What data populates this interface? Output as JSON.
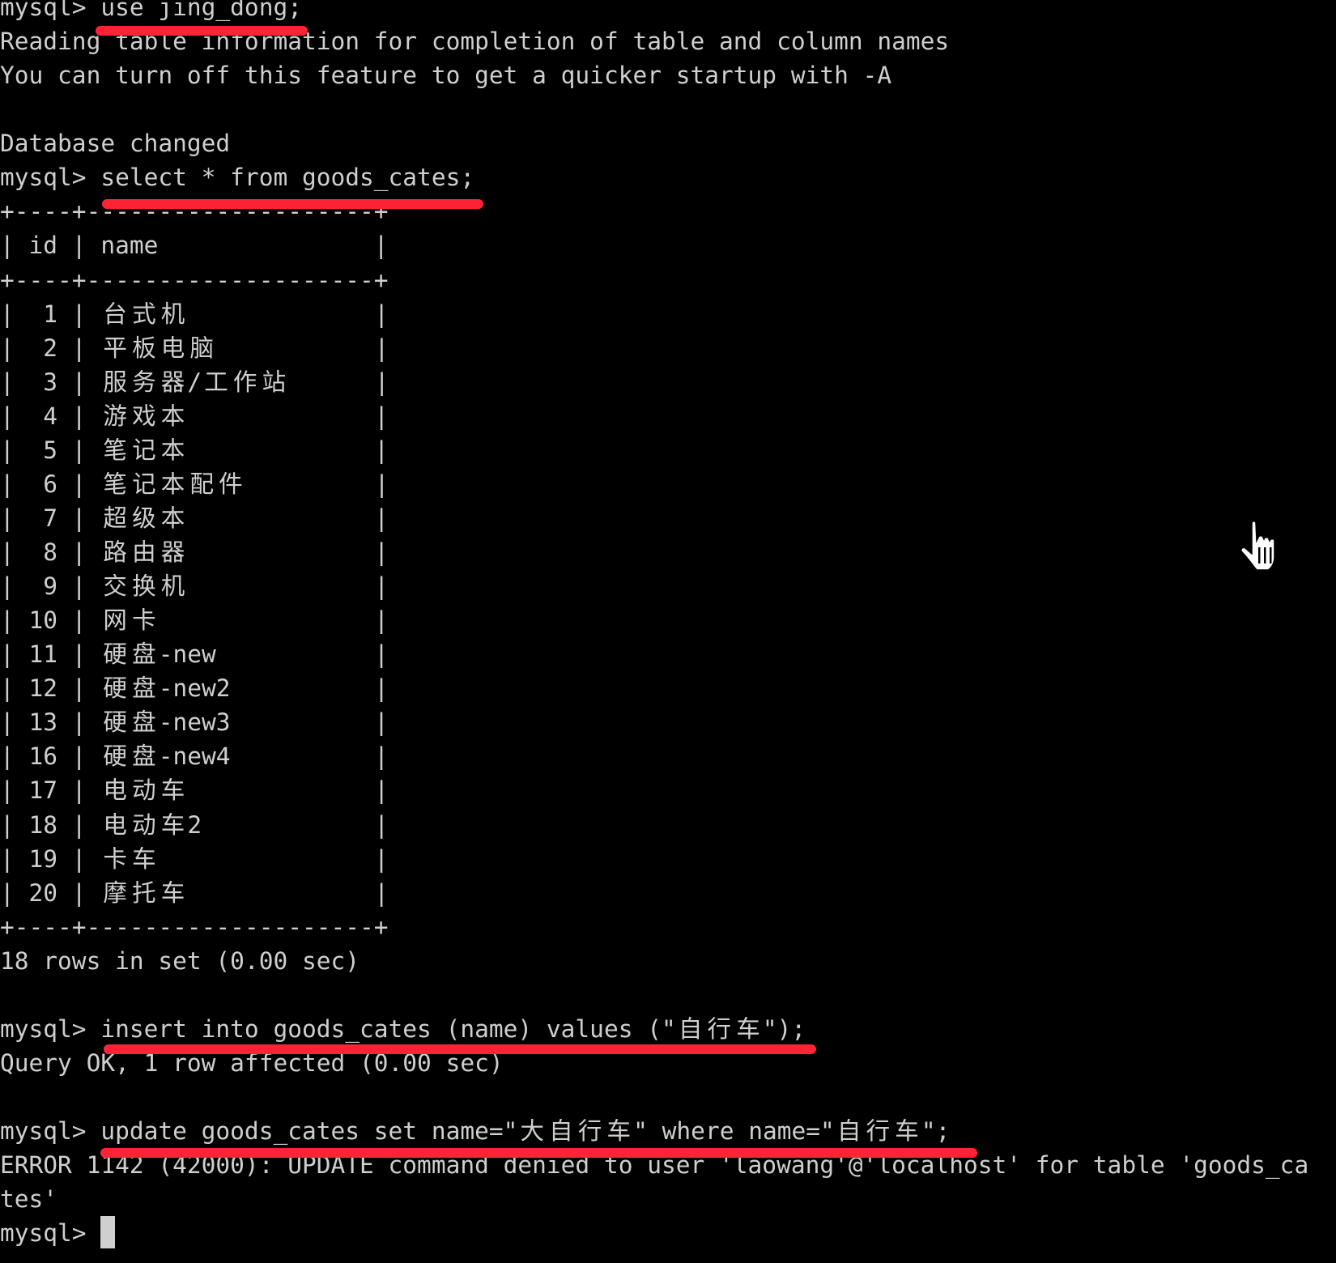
{
  "terminal": {
    "prompt": "mysql> ",
    "lines": [
      {
        "type": "command",
        "text": "use jing_dong;"
      },
      {
        "type": "output",
        "text": "Reading table information for completion of table and column names"
      },
      {
        "type": "output",
        "text": "You can turn off this feature to get a quicker startup with -A"
      },
      {
        "type": "blank",
        "text": ""
      },
      {
        "type": "output",
        "text": "Database changed"
      },
      {
        "type": "command",
        "text": "select * from goods_cates;"
      }
    ],
    "table": {
      "border": "+----+--------------------+",
      "columns": [
        "id",
        "name"
      ],
      "rows": [
        {
          "id": "1",
          "name": "台式机"
        },
        {
          "id": "2",
          "name": "平板电脑"
        },
        {
          "id": "3",
          "name": "服务器/工作站"
        },
        {
          "id": "4",
          "name": "游戏本"
        },
        {
          "id": "5",
          "name": "笔记本"
        },
        {
          "id": "6",
          "name": "笔记本配件"
        },
        {
          "id": "7",
          "name": "超级本"
        },
        {
          "id": "8",
          "name": "路由器"
        },
        {
          "id": "9",
          "name": "交换机"
        },
        {
          "id": "10",
          "name": "网卡"
        },
        {
          "id": "11",
          "name": "硬盘-new"
        },
        {
          "id": "12",
          "name": "硬盘-new2"
        },
        {
          "id": "13",
          "name": "硬盘-new3"
        },
        {
          "id": "16",
          "name": "硬盘-new4"
        },
        {
          "id": "17",
          "name": "电动车"
        },
        {
          "id": "18",
          "name": "电动车2"
        },
        {
          "id": "19",
          "name": "卡车"
        },
        {
          "id": "20",
          "name": "摩托车"
        }
      ],
      "summary": "18 rows in set (0.00 sec)"
    },
    "after": [
      {
        "type": "blank",
        "text": ""
      },
      {
        "type": "command",
        "text": "insert into goods_cates (name) values (\"自行车\");"
      },
      {
        "type": "output",
        "text": "Query OK, 1 row affected (0.00 sec)"
      },
      {
        "type": "blank",
        "text": ""
      },
      {
        "type": "command",
        "text": "update goods_cates set name=\"大自行车\" where name=\"自行车\";"
      },
      {
        "type": "error",
        "text": "ERROR 1142 (42000): UPDATE command denied to user 'laowang'@'localhost' for table 'goods_ca"
      },
      {
        "type": "output",
        "text": "tes'"
      },
      {
        "type": "prompt",
        "text": ""
      }
    ]
  },
  "annotations": {
    "underline_color": "#ff2335",
    "underlined_commands": [
      "use jing_dong;",
      "select * from goods_cates;",
      "insert into goods_cates (name) values (\"自行车\");",
      "update goods_cates set name=\"大自行车\" where name=\"自行车\";"
    ]
  },
  "pointer": {
    "icon": "hand-pointer-icon"
  }
}
